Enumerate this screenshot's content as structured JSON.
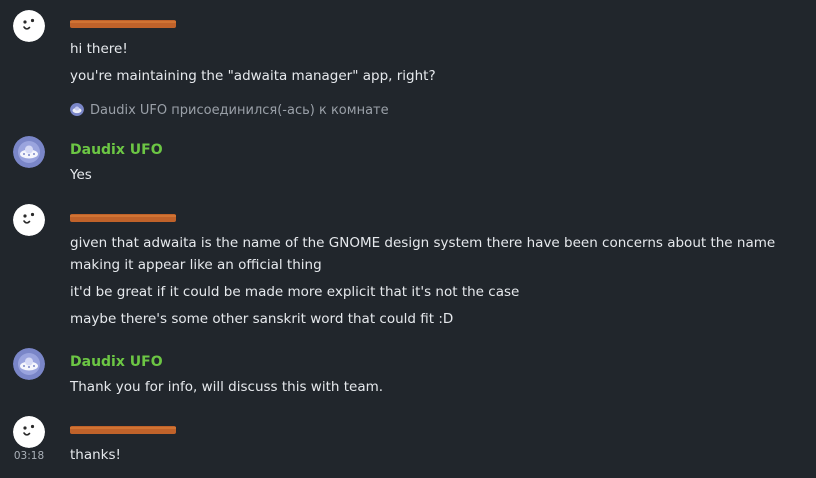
{
  "colors": {
    "background": "#21262c",
    "text": "#e6e9ed",
    "muted_text": "#9aa0a8",
    "daudix_name": "#6cc644",
    "redaction": "#c0622a"
  },
  "messages": [
    {
      "sender": "",
      "sender_redacted": true,
      "avatar_icon": "smiley-avatar-icon",
      "lines": [
        "hi there!",
        "you're maintaining the \"adwaita manager\" app, right?"
      ]
    },
    {
      "state_event": "Daudix UFO присоединился(-ась) к комнате",
      "avatar_icon": "daudix-avatar-icon"
    },
    {
      "sender": "Daudix UFO",
      "avatar_icon": "daudix-avatar-icon",
      "lines": [
        "Yes"
      ]
    },
    {
      "sender": "",
      "sender_redacted": true,
      "avatar_icon": "smiley-avatar-icon",
      "lines": [
        "given that adwaita is the name of the GNOME design system there have been concerns about the name making it appear like an official thing",
        "it'd be great if it could be made more explicit that it's not the case",
        "maybe there's some other sanskrit word that could fit :D"
      ]
    },
    {
      "sender": "Daudix UFO",
      "avatar_icon": "daudix-avatar-icon",
      "lines": [
        "Thank you for info, will discuss this with team."
      ]
    },
    {
      "sender": "",
      "sender_redacted": true,
      "avatar_icon": "smiley-avatar-icon",
      "timestamp": "03:18",
      "lines": [
        "thanks!"
      ]
    }
  ]
}
